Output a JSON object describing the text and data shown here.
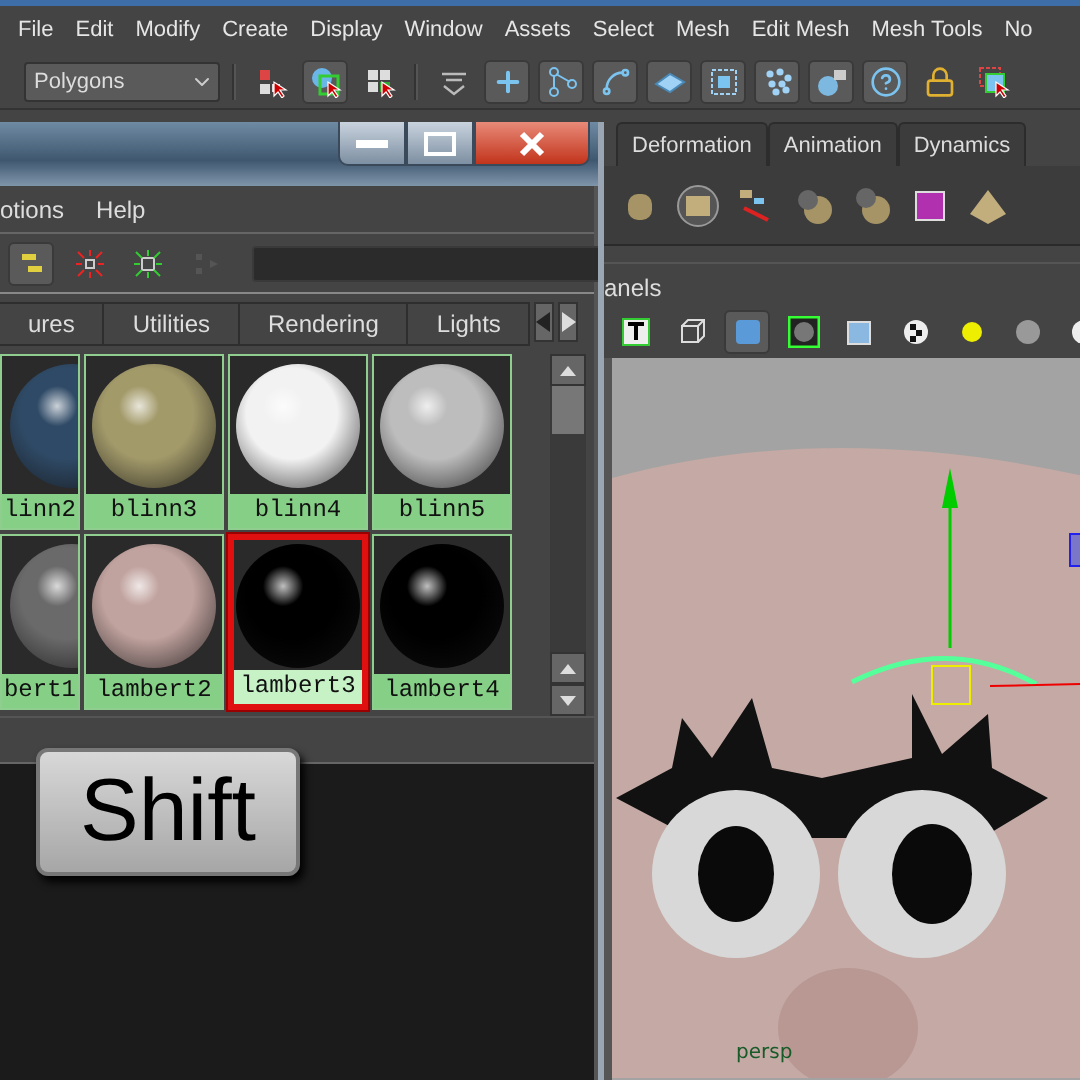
{
  "menu_bar": {
    "items": [
      "File",
      "Edit",
      "Modify",
      "Create",
      "Display",
      "Window",
      "Assets",
      "Select",
      "Mesh",
      "Edit Mesh",
      "Mesh Tools",
      "No"
    ]
  },
  "toolbar": {
    "mode_dropdown": "Polygons"
  },
  "hypershade": {
    "menu": [
      "otions",
      "Help"
    ],
    "tabs": [
      {
        "label": "ures",
        "selected": false
      },
      {
        "label": "Utilities",
        "selected": false
      },
      {
        "label": "Rendering",
        "selected": false
      },
      {
        "label": "Lights",
        "selected": false
      }
    ],
    "swatches": [
      {
        "name": "linn2",
        "color": "#2f4a66",
        "selected": false
      },
      {
        "name": "blinn3",
        "color": "#a39a6a",
        "selected": false
      },
      {
        "name": "blinn4",
        "color": "#f2f2f2",
        "selected": false
      },
      {
        "name": "blinn5",
        "color": "#bdbdbd",
        "selected": false
      },
      {
        "name": "bert1",
        "color": "#6a6a6a",
        "selected": false
      },
      {
        "name": "lambert2",
        "color": "#c0a29e",
        "selected": false
      },
      {
        "name": "lambert3",
        "color": "#000000",
        "selected": true
      },
      {
        "name": "lambert4",
        "color": "#000000",
        "selected": false
      }
    ],
    "key_overlay": "Shift"
  },
  "shelf": {
    "tabs": [
      {
        "label": "Deformation",
        "selected": false
      },
      {
        "label": "Animation",
        "selected": false
      },
      {
        "label": "Dynamics",
        "selected": false
      }
    ]
  },
  "panel": {
    "menu": "anels"
  },
  "viewport": {
    "camera": "persp"
  }
}
